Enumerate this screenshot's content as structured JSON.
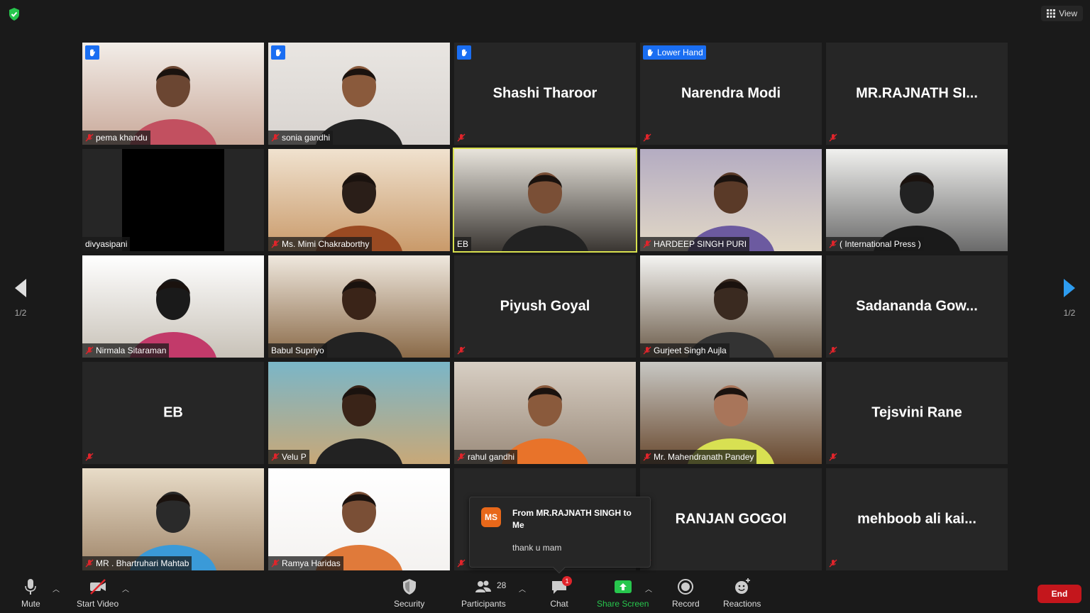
{
  "top": {
    "view_label": "View"
  },
  "pagination": {
    "left": "1/2",
    "right": "1/2"
  },
  "tiles": [
    {
      "name": "pema khandu",
      "type": "video",
      "muted": true,
      "hand": true,
      "bg": [
        "#f2ede8",
        "#c9a99a"
      ],
      "face": "#6b4632",
      "shirt": "#c25060"
    },
    {
      "name": "sonia gandhi",
      "type": "video",
      "muted": true,
      "hand": true,
      "bg": [
        "#e9e6e2",
        "#d8d3cf"
      ],
      "face": "#8a5a3c",
      "shirt": "#222"
    },
    {
      "name": "Shashi Tharoor",
      "type": "name",
      "muted": true,
      "hand": true
    },
    {
      "name": "Narendra Modi",
      "type": "name",
      "muted": true,
      "hand_label": "Lower Hand"
    },
    {
      "name": "MR.RAJNATH  SI...",
      "type": "name",
      "muted": true
    },
    {
      "name": "divyasipani",
      "type": "black",
      "muted": false
    },
    {
      "name": "Ms. Mimi Chakraborthy",
      "type": "video",
      "muted": true,
      "bg": [
        "#f0e2cf",
        "#c99a6a"
      ],
      "face": "#2a1e18",
      "shirt": "#9a4a22"
    },
    {
      "name": "EB",
      "type": "video",
      "muted": false,
      "active": true,
      "bg": [
        "#e8e4dc",
        "#3a3632"
      ],
      "face": "#7a4f36",
      "shirt": "#222"
    },
    {
      "name": "HARDEEP SINGH PURI",
      "type": "video",
      "muted": true,
      "bg": [
        "#b4acc2",
        "#e2d8c6"
      ],
      "face": "#5a3a28",
      "shirt": "#6c5aa0"
    },
    {
      "name": "( International Press )",
      "type": "video",
      "muted": true,
      "bg": [
        "#f0f0ee",
        "#6a6a6a"
      ],
      "face": "#222",
      "shirt": "#1a1a1a"
    },
    {
      "name": "Nirmala Sitaraman",
      "type": "video",
      "muted": true,
      "bg": [
        "#ffffff",
        "#c8c2b8"
      ],
      "face": "#1a1a1a",
      "shirt": "#c23a6a"
    },
    {
      "name": "Babul Supriyo",
      "type": "video",
      "muted": false,
      "bg": [
        "#efe8de",
        "#8a6a48"
      ],
      "face": "#3a2418",
      "shirt": "#222"
    },
    {
      "name": "Piyush Goyal",
      "type": "name",
      "muted": true
    },
    {
      "name": "Gurjeet Singh Aujla",
      "type": "video",
      "muted": true,
      "bg": [
        "#f4f4f2",
        "#6a5a48"
      ],
      "face": "#3a2a20",
      "shirt": "#333"
    },
    {
      "name": "Sadananda  Gow...",
      "type": "name",
      "muted": true
    },
    {
      "name": "EB",
      "type": "name",
      "muted": true
    },
    {
      "name": "Velu P",
      "type": "video",
      "muted": true,
      "bg": [
        "#7ab6c8",
        "#c8a878"
      ],
      "face": "#3a2418",
      "shirt": "#222"
    },
    {
      "name": "rahul gandhi",
      "type": "video",
      "muted": true,
      "bg": [
        "#d8cfc4",
        "#9a8a7a"
      ],
      "face": "#8a5a3c",
      "shirt": "#e8732a"
    },
    {
      "name": "Mr. Mahendranath Pandey",
      "type": "video",
      "muted": true,
      "bg": [
        "#c8c8c4",
        "#6a4a30"
      ],
      "face": "#a8755a",
      "shirt": "#d8e052"
    },
    {
      "name": "Tejsvini Rane",
      "type": "name",
      "muted": true
    },
    {
      "name": "MR . Bhartruhari Mahtab",
      "type": "video",
      "muted": true,
      "bg": [
        "#e8dcc8",
        "#a0866a"
      ],
      "face": "#2a2a2a",
      "shirt": "#3a9ad8"
    },
    {
      "name": "Ramya Haridas",
      "type": "video",
      "muted": true,
      "bg": [
        "#ffffff",
        "#f4f2f0"
      ],
      "face": "#7a4f36",
      "shirt": "#e07a3a"
    },
    {
      "name": "",
      "type": "name",
      "muted": true
    },
    {
      "name": "RANJAN GOGOI",
      "type": "name",
      "muted": true
    },
    {
      "name": "mehboob ali kai...",
      "type": "name",
      "muted": true
    }
  ],
  "chat_toast": {
    "initials": "MS",
    "from": "From MR.RAJNATH SINGH to Me",
    "message": "thank u mam"
  },
  "toolbar": {
    "mute": "Mute",
    "start_video": "Start Video",
    "security": "Security",
    "participants": "Participants",
    "participants_count": "28",
    "chat": "Chat",
    "chat_badge": "1",
    "share_screen": "Share Screen",
    "record": "Record",
    "reactions": "Reactions",
    "end": "End"
  },
  "colors": {
    "accent_blue": "#1a6ef2",
    "active_border": "#d8e04e",
    "share_green": "#27c64d",
    "end_red": "#c4161c"
  }
}
